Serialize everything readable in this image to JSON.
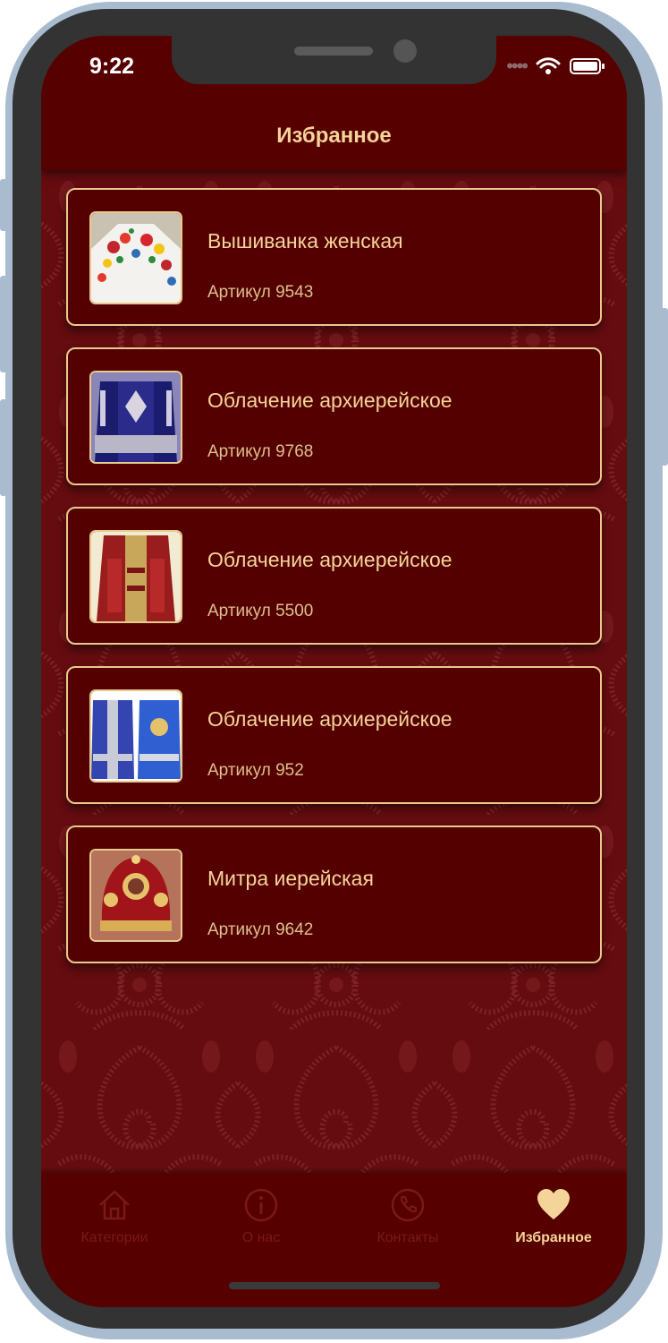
{
  "status_bar": {
    "time": "9:22"
  },
  "header": {
    "title": "Избранное"
  },
  "favorites": [
    {
      "title": "Вышиванка женская",
      "sku": "Артикул 9543"
    },
    {
      "title": "Облачение архиерейское",
      "sku": "Артикул 9768"
    },
    {
      "title": "Облачение архиерейское",
      "sku": "Артикул 5500"
    },
    {
      "title": "Облачение архиерейское",
      "sku": "Артикул 952"
    },
    {
      "title": "Митра иерейская",
      "sku": "Артикул 9642"
    }
  ],
  "tabbar": {
    "tabs": [
      {
        "label": "Категории",
        "icon": "home-icon",
        "active": false
      },
      {
        "label": "О нас",
        "icon": "info-icon",
        "active": false
      },
      {
        "label": "Контакты",
        "icon": "phone-icon",
        "active": false
      },
      {
        "label": "Избранное",
        "icon": "heart-icon",
        "active": true
      }
    ]
  },
  "colors": {
    "background": "#560000",
    "accent": "#f5d49a",
    "card_border": "#e8c98e",
    "inactive_tab": "#7a1a14"
  }
}
